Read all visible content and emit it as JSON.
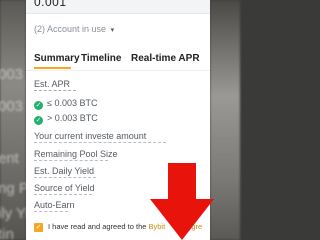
{
  "background": {
    "ghost_left_lines": [
      "003 B",
      "003 B",
      "ent",
      "ng P",
      "ily Yi",
      "tin"
    ]
  },
  "amount": {
    "value": "0.001"
  },
  "account": {
    "label": "(2) Account in use",
    "caret": "▾"
  },
  "tabs": [
    {
      "label": "Summary",
      "active": true
    },
    {
      "label": "Timeline",
      "active": false
    },
    {
      "label": "Real-time APR",
      "active": false
    }
  ],
  "summary": {
    "apr_label": "Est. APR",
    "tiers": [
      {
        "label": "≤ 0.003 BTC"
      },
      {
        "label": "> 0.003 BTC"
      }
    ],
    "rows": [
      {
        "label": "Your current investe  amount"
      },
      {
        "label": "Remaining Pool Size"
      },
      {
        "label": "Est. Daily Yield"
      },
      {
        "label": "Source of Yield"
      },
      {
        "label": "Auto-Earn"
      }
    ]
  },
  "agreement": {
    "text": "I have read and agreed to the ",
    "link": "Bybit",
    "trail": "agre"
  },
  "colors": {
    "accent": "#f5a623",
    "check": "#20b26c",
    "arrow": "#e8140c"
  },
  "icons": {
    "checkmark": "check-icon",
    "arrow": "arrow-down-icon"
  }
}
